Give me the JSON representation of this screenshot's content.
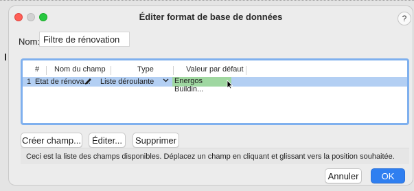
{
  "window": {
    "title": "Éditer format de base de données",
    "help_label": "?"
  },
  "name_field": {
    "label": "Nom:",
    "value": "Filtre de rénovation"
  },
  "table": {
    "columns": [
      "#",
      "Nom du champ",
      "Type",
      "Valeur par défaut"
    ],
    "rows": [
      {
        "index": "1",
        "field_name": "Etat de rénova...",
        "type": "Liste déroulante",
        "default_value": "Energos Buildin..."
      }
    ]
  },
  "buttons": {
    "create": "Créer champ...",
    "edit": "Éditer...",
    "delete": "Supprimer",
    "cancel": "Annuler",
    "ok": "OK"
  },
  "hint": "Ceci est la liste des champs disponibles. Déplacez un champ en cliquant et glissant vers la position souhaitée.",
  "colors": {
    "accent": "#2f7ff0",
    "selection": "#b3cff3",
    "default_value_highlight": "#9fd7a1"
  },
  "icons": [
    "close-icon",
    "minimize-icon",
    "maximize-icon",
    "help-icon",
    "pencil-icon",
    "chevron-down-icon",
    "mouse-cursor-icon"
  ]
}
